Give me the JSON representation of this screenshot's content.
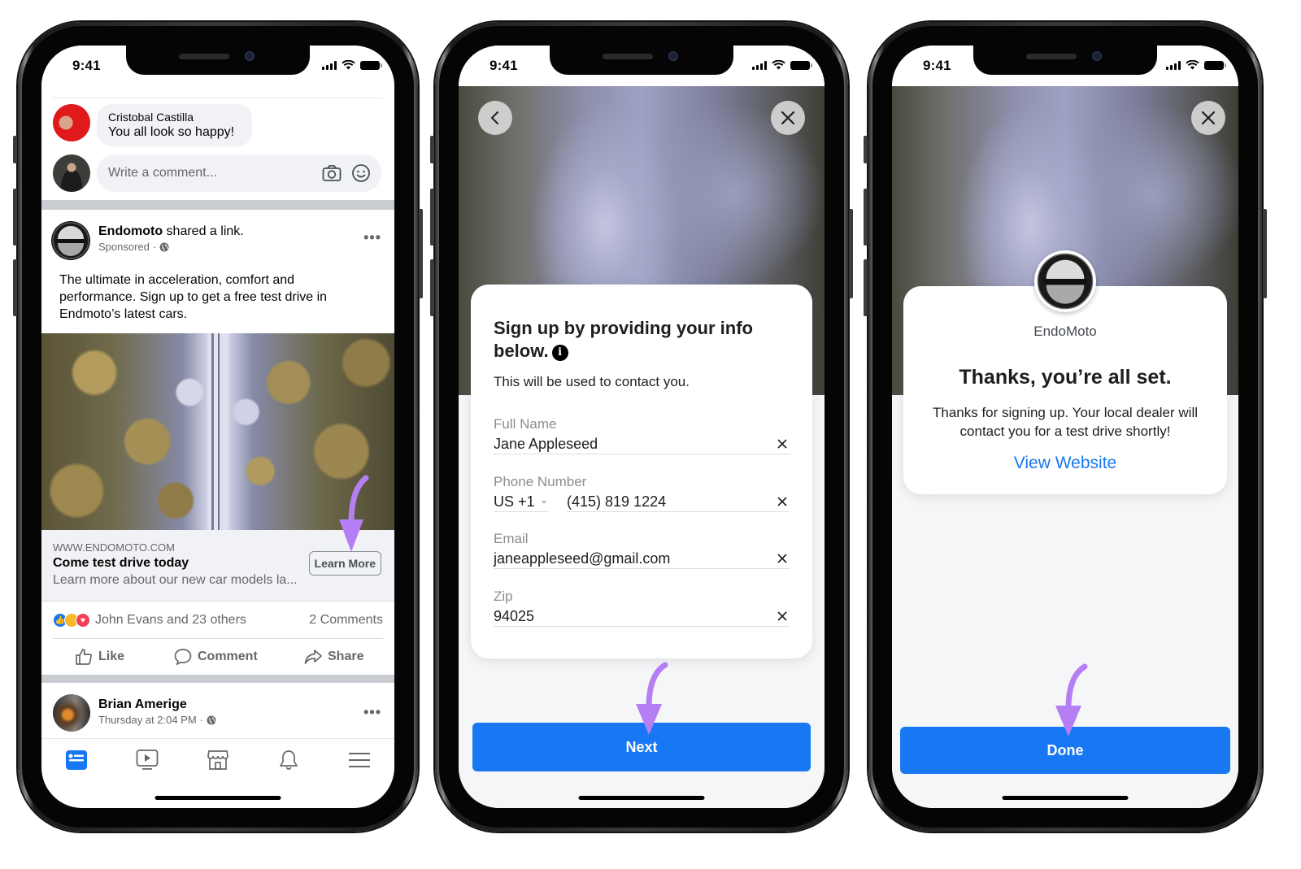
{
  "status_bar": {
    "time": "9:41"
  },
  "accent": {
    "facebook_blue": "#1877f2",
    "annotation_purple": "#b57ef5"
  },
  "phone1": {
    "comment": {
      "author": "Cristobal Castilla",
      "text": "You all look so happy!"
    },
    "comment_input": {
      "placeholder": "Write a comment...",
      "icons": [
        "camera-icon",
        "emoji-icon"
      ]
    },
    "post": {
      "page_name": "Endomoto",
      "action_text": "shared a link.",
      "sub_label": "Sponsored",
      "separator": "·",
      "body": "The ultimate in acceleration, comfort and performance. Sign up to get a free test drive in Endmoto’s latest cars.",
      "link_preview": {
        "domain": "WWW.ENDOMOTO.COM",
        "title": "Come test drive today",
        "description": "Learn more about our new car models la...",
        "cta_label": "Learn More"
      },
      "reactions_text": "John Evans and 23 others",
      "reaction_types": [
        "like",
        "wow",
        "love"
      ],
      "comments_count": "2 Comments",
      "actions": [
        {
          "label": "Like",
          "icon": "thumbs-up-icon"
        },
        {
          "label": "Comment",
          "icon": "comment-bubble-icon"
        },
        {
          "label": "Share",
          "icon": "share-arrow-icon"
        }
      ]
    },
    "next_post": {
      "author": "Brian Amerige",
      "timestamp": "Thursday at 2:04 PM",
      "separator": "·"
    },
    "tabbar": [
      {
        "name": "news-feed",
        "icon": "news-feed-icon",
        "active": true
      },
      {
        "name": "watch",
        "icon": "video-play-icon",
        "active": false
      },
      {
        "name": "marketplace",
        "icon": "marketplace-shop-icon",
        "active": false
      },
      {
        "name": "notifications",
        "icon": "bell-icon",
        "active": false
      },
      {
        "name": "menu",
        "icon": "hamburger-menu-icon",
        "active": false
      }
    ],
    "more_label": "•••"
  },
  "phone2": {
    "title": "Sign up by providing your info below.",
    "title_line1": "Sign up by providing your info",
    "title_line2": "below.",
    "info_icon": "i",
    "subtitle": "This will be used to contact you.",
    "fields": [
      {
        "label": "Full Name",
        "value": "Jane Appleseed"
      },
      {
        "label": "Phone Number",
        "country_code": "US +1",
        "value": "(415) 819 1224"
      },
      {
        "label": "Email",
        "value": "janeappleseed@gmail.com"
      },
      {
        "label": "Zip",
        "value": "94025"
      }
    ],
    "primary_button": "Next"
  },
  "phone3": {
    "brand_name": "EndoMoto",
    "title": "Thanks, you’re all set.",
    "body_line1": "Thanks for signing up. Your local dealer will",
    "body_line2": "contact you for a test drive shortly!",
    "link_label": "View Website",
    "primary_button": "Done"
  }
}
